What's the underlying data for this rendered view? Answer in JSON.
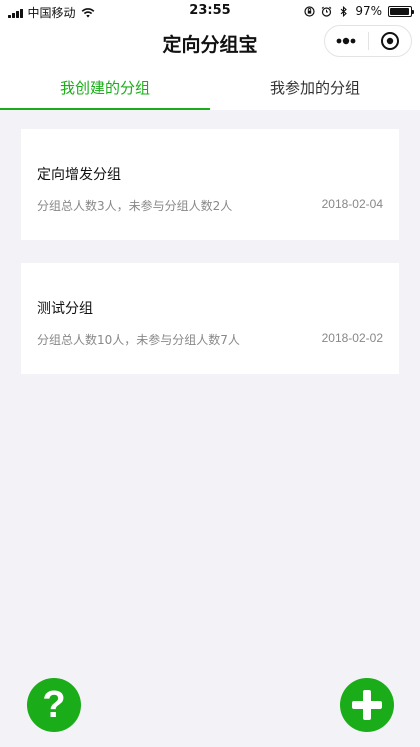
{
  "status_bar": {
    "carrier": "中国移动",
    "time": "23:55",
    "battery": "97%"
  },
  "nav": {
    "title": "定向分组宝"
  },
  "tabs": [
    {
      "label": "我创建的分组",
      "active": true
    },
    {
      "label": "我参加的分组",
      "active": false
    }
  ],
  "groups": [
    {
      "title": "定向增发分组",
      "desc": "分组总人数3人，未参与分组人数2人",
      "date": "2018-02-04"
    },
    {
      "title": "测试分组",
      "desc": "分组总人数10人，未参与分组人数7人",
      "date": "2018-02-02"
    }
  ],
  "colors": {
    "accent": "#1aad19",
    "background": "#f3f2f6"
  },
  "icons": {
    "help": "question-mark-icon",
    "add": "plus-icon"
  }
}
